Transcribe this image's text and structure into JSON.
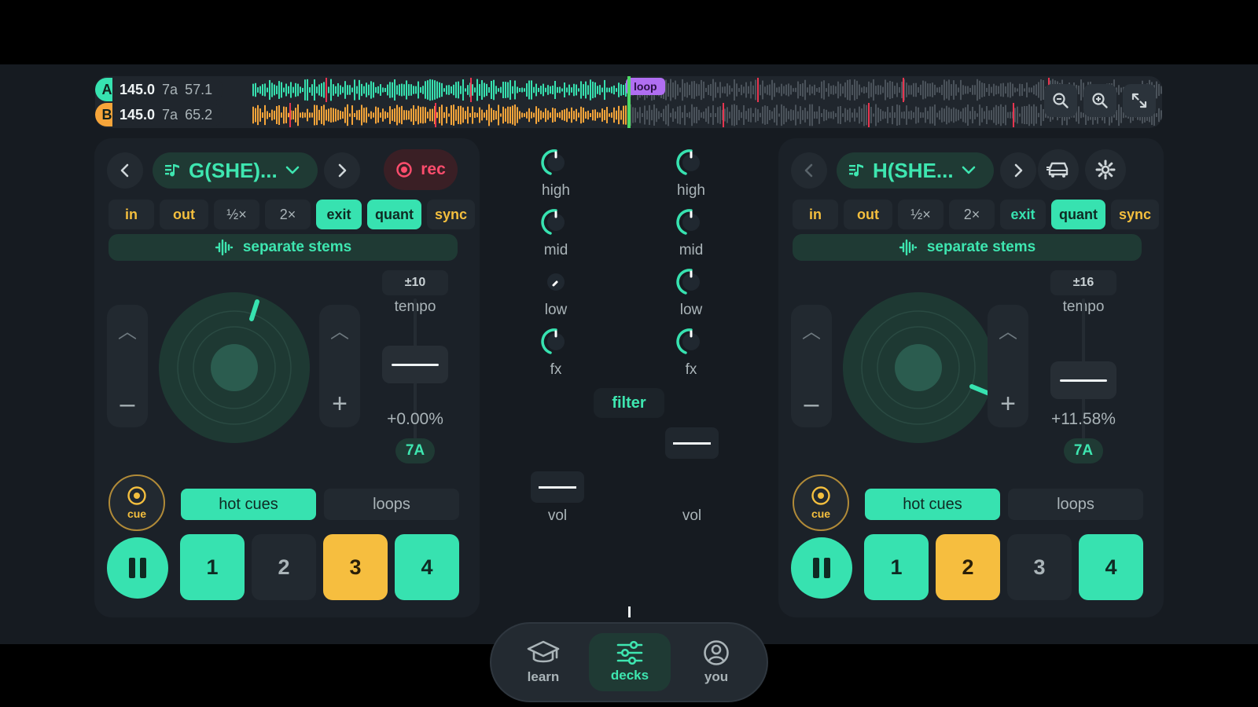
{
  "overview": {
    "deck_a": {
      "letter": "A",
      "bpm": "145.0",
      "key": "7a",
      "position": "57.1",
      "color": "#37e2b0"
    },
    "deck_b": {
      "letter": "B",
      "bpm": "145.0",
      "key": "7a",
      "position": "65.2",
      "color": "#f6a53a"
    },
    "loop_label": "loop",
    "tools": [
      "zoom-out-icon",
      "zoom-in-icon",
      "expand-icon"
    ]
  },
  "left_deck": {
    "track": "G(SHE)...",
    "rec_label": "rec",
    "loop_controls": [
      "in",
      "out",
      "½×",
      "2×",
      "exit",
      "quant",
      "sync"
    ],
    "stems_label": "separate stems",
    "tempo_range": "±10",
    "tempo_label": "tempo",
    "tempo_value": "+0.00%",
    "key": "7A",
    "cue_label": "cue",
    "tabs": {
      "hot_cues": "hot cues",
      "loops": "loops"
    },
    "pads": [
      "1",
      "2",
      "3",
      "4"
    ],
    "pad_colors": [
      "green",
      "empty",
      "yellow",
      "green"
    ]
  },
  "right_deck": {
    "track": "H(SHE...",
    "loop_controls": [
      "in",
      "out",
      "½×",
      "2×",
      "exit",
      "quant",
      "sync"
    ],
    "stems_label": "separate stems",
    "tempo_range": "±16",
    "tempo_label": "tempo",
    "tempo_value": "+11.58%",
    "key": "7A",
    "cue_label": "cue",
    "tabs": {
      "hot_cues": "hot cues",
      "loops": "loops"
    },
    "pads": [
      "1",
      "2",
      "3",
      "4"
    ],
    "pad_colors": [
      "green",
      "yellow",
      "empty",
      "green"
    ]
  },
  "mixer": {
    "eq_labels": [
      "high",
      "mid",
      "low",
      "fx"
    ],
    "filter_label": "filter",
    "vol_label": "vol"
  },
  "nav": {
    "learn": "learn",
    "decks": "decks",
    "you": "you"
  },
  "colors": {
    "accent": "#37e2b0",
    "cue_yellow": "#f6be3f",
    "rec_red": "#ff4d6d",
    "loop_purple": "#b06ef2"
  }
}
